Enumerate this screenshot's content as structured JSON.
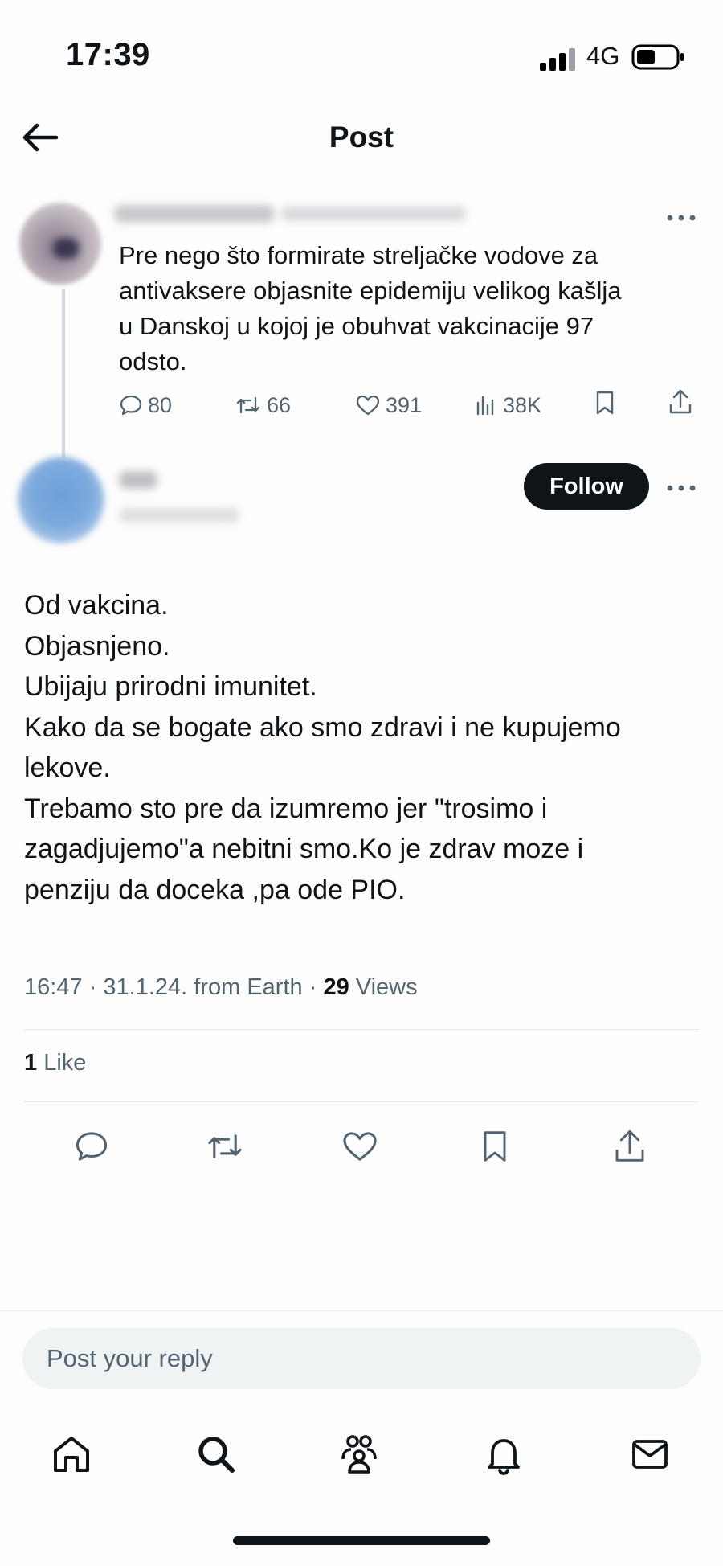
{
  "status_bar": {
    "time": "17:39",
    "network": "4G"
  },
  "header": {
    "title": "Post"
  },
  "parent_tweet": {
    "text_lines": [
      "Pre nego što formirate streljačke vodove za",
      "antivaksere objasnite epidemiju velikog kašlja",
      "u Danskoj u kojoj je obuhvat vakcinacije 97",
      "odsto."
    ],
    "stats": {
      "replies": "80",
      "retweets": "66",
      "likes": "391",
      "views": "38K"
    }
  },
  "main_tweet": {
    "follow_label": "Follow",
    "body_lines": [
      "Od vakcina.",
      "Objasnjeno.",
      "Ubijaju prirodni  imunitet.",
      "Kako da se bogate ako smo zdravi i ne kupujemo",
      "lekove.",
      "Trebamo sto pre da izumremo jer \"trosimo i",
      "zagadjujemo\"a nebitni smo.Ko je zdrav moze i",
      "penziju da doceka ,pa ode PIO."
    ],
    "meta": {
      "time": "16:47",
      "date": "31.1.24.",
      "source": "from Earth",
      "views_count": "29",
      "views_label": "Views"
    },
    "likes": {
      "count": "1",
      "label": "Like"
    }
  },
  "reply": {
    "placeholder": "Post your reply"
  },
  "icons": {
    "back": "arrow-left-icon",
    "more": "more-horizontal-icon",
    "reply": "speech-bubble-icon",
    "retweet": "retweet-icon",
    "like": "heart-icon",
    "views": "bar-chart-icon",
    "bookmark": "bookmark-icon",
    "share": "share-icon",
    "home": "home-icon",
    "search": "search-icon",
    "communities": "people-icon",
    "notifications": "bell-icon",
    "messages": "envelope-icon"
  },
  "colors": {
    "text": "#0f1419",
    "secondary": "#536471",
    "divider": "#e7e9ea",
    "follow_bg": "#0f1419"
  }
}
